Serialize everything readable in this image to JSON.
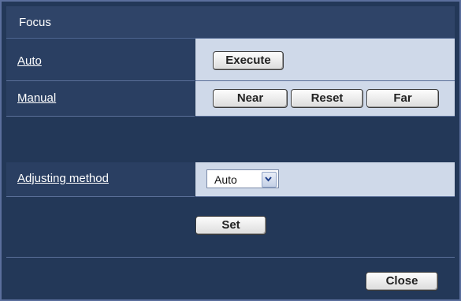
{
  "window": {
    "title": "Focus"
  },
  "rows": {
    "auto": {
      "label": "Auto",
      "execute_label": "Execute"
    },
    "manual": {
      "label": "Manual",
      "near_label": "Near",
      "reset_label": "Reset",
      "far_label": "Far"
    },
    "adjusting": {
      "label": "Adjusting method",
      "selected_value": "Auto"
    }
  },
  "actions": {
    "set_label": "Set",
    "close_label": "Close"
  },
  "colors": {
    "panel_bg": "#233858",
    "label_cell_bg": "#2a3f62",
    "value_cell_bg": "#cfd9e9",
    "border": "#5b6f9c"
  },
  "icons": {
    "dropdown": "chevron-down-icon"
  }
}
